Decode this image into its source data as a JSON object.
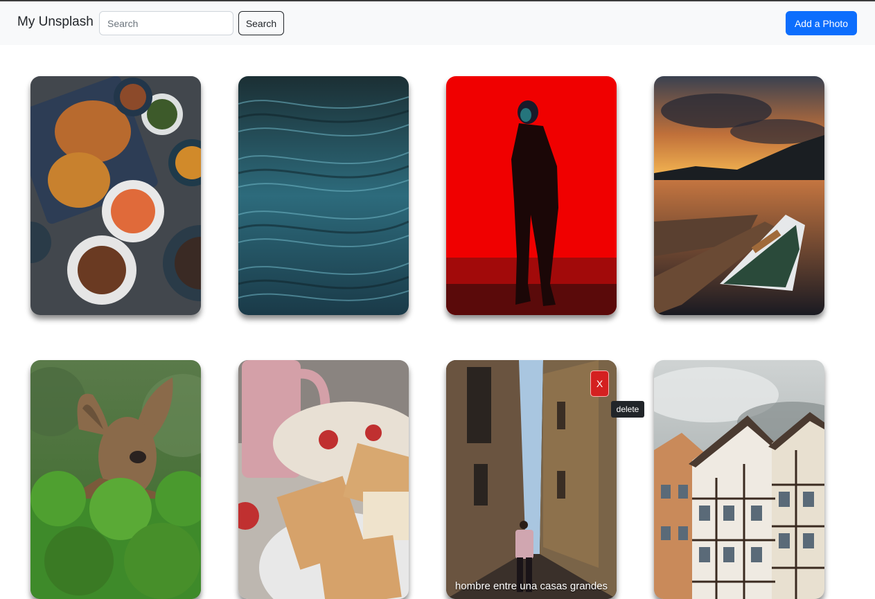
{
  "navbar": {
    "brand": "My Unsplash",
    "search_placeholder": "Search",
    "search_button": "Search",
    "add_button": "Add a Photo"
  },
  "photos": [
    {
      "subject": "korean-food-dishes"
    },
    {
      "subject": "teal-water-waves"
    },
    {
      "subject": "silhouette-red-background"
    },
    {
      "subject": "lake-boat-sunset"
    },
    {
      "subject": "deer-in-greenery"
    },
    {
      "subject": "crackers-and-pink-mug"
    },
    {
      "subject": "narrow-street-man-walking",
      "caption": "hombre entre una casas grandes",
      "delete_label": "X",
      "tooltip": "delete"
    },
    {
      "subject": "timber-framed-houses"
    }
  ],
  "colors": {
    "brand_blue": "#0d6efd",
    "delete_red": "#d42020",
    "navbar_bg": "#f8f9fa"
  }
}
